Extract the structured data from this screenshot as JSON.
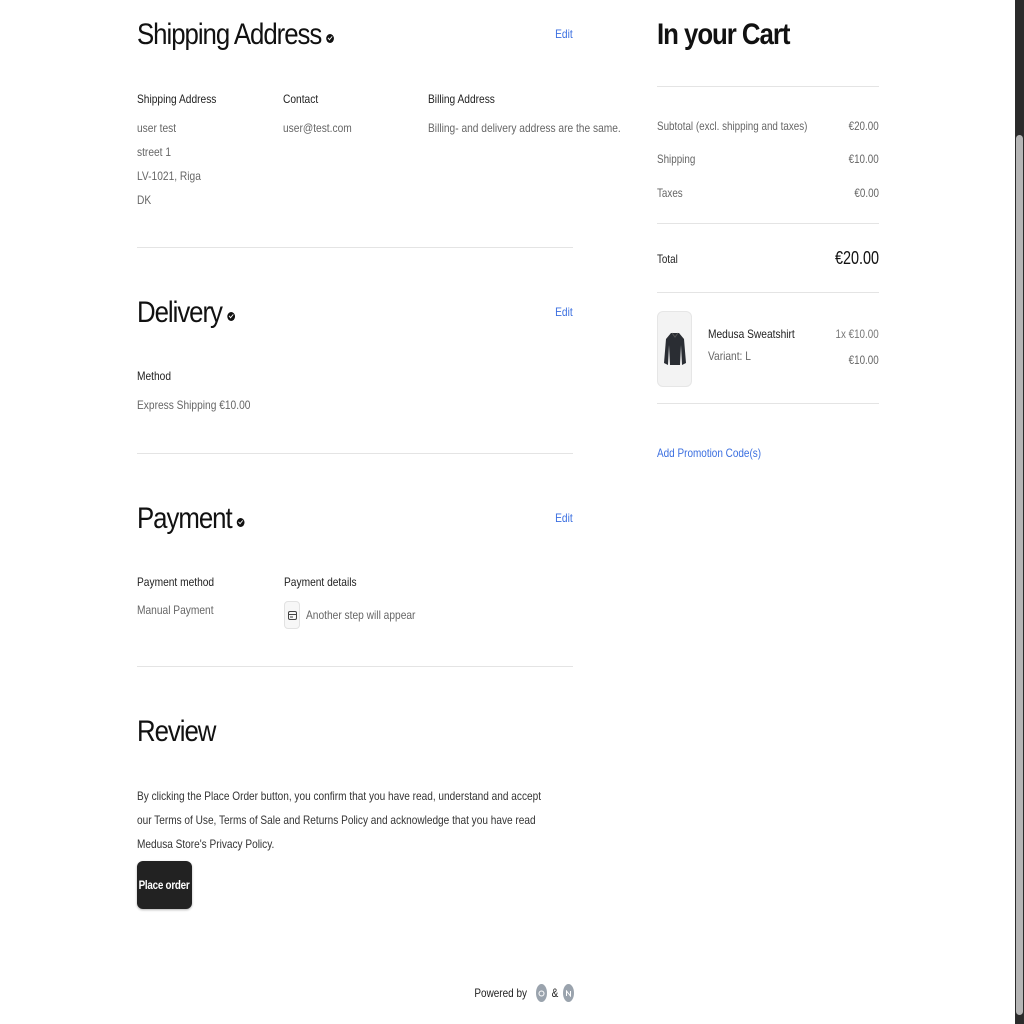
{
  "shipping": {
    "title": "Shipping Address",
    "edit": "Edit",
    "address_label": "Shipping Address",
    "address_lines": [
      "user test",
      "street 1",
      "LV-1021, Riga",
      "DK"
    ],
    "contact_label": "Contact",
    "contact_value": "user@test.com",
    "billing_label": "Billing Address",
    "billing_value": "Billing- and delivery address are the same."
  },
  "delivery": {
    "title": "Delivery",
    "edit": "Edit",
    "method_label": "Method",
    "method_value": "Express Shipping €10.00"
  },
  "payment": {
    "title": "Payment",
    "edit": "Edit",
    "method_label": "Payment method",
    "method_value": "Manual Payment",
    "details_label": "Payment details",
    "details_value": "Another step will appear"
  },
  "review": {
    "title": "Review",
    "text": "By clicking the Place Order button, you confirm that you have read, understand and accept our Terms of Use, Terms of Sale and Returns Policy and acknowledge that you have read Medusa Store's Privacy Policy.",
    "button": "Place order"
  },
  "cart": {
    "title": "In your Cart",
    "subtotal_label": "Subtotal (excl. shipping and taxes)",
    "subtotal_value": "€20.00",
    "shipping_label": "Shipping",
    "shipping_value": "€10.00",
    "taxes_label": "Taxes",
    "taxes_value": "€0.00",
    "total_label": "Total",
    "total_value": "€20.00",
    "item": {
      "name": "Medusa Sweatshirt",
      "variant": "Variant: L",
      "qty_price": "1x €10.00",
      "line_total": "€10.00"
    },
    "promo": "Add Promotion Code(s)"
  },
  "footer": {
    "powered_by": "Powered by",
    "amp": "&"
  },
  "colors": {
    "link": "#3b6fe0",
    "button_bg": "#222222"
  }
}
